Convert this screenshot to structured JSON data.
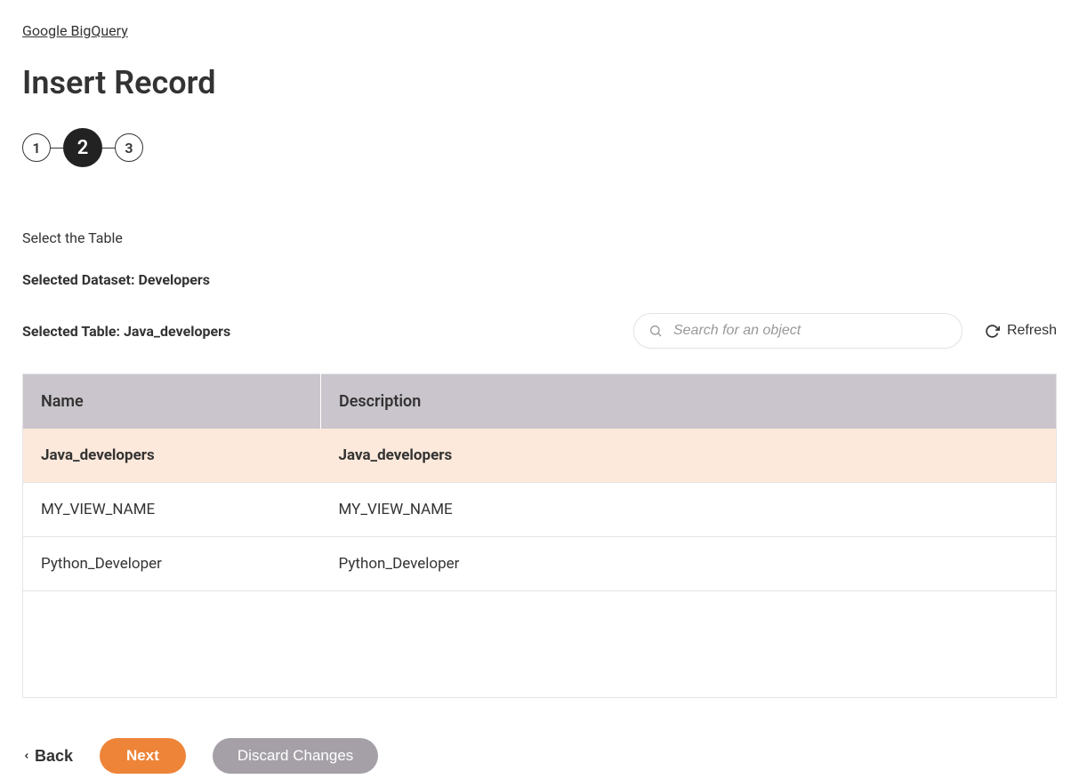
{
  "breadcrumb": {
    "label": "Google BigQuery"
  },
  "page_title": "Insert Record",
  "stepper": {
    "steps": [
      "1",
      "2",
      "3"
    ],
    "active_index": 1
  },
  "instruction": "Select the Table",
  "selected_dataset_line": "Selected Dataset: Developers",
  "selected_table_line": "Selected Table: Java_developers",
  "search": {
    "placeholder": "Search for an object"
  },
  "refresh_label": "Refresh",
  "table": {
    "headers": {
      "name": "Name",
      "description": "Description"
    },
    "rows": [
      {
        "name": "Java_developers",
        "description": "Java_developers",
        "selected": true
      },
      {
        "name": "MY_VIEW_NAME",
        "description": "MY_VIEW_NAME",
        "selected": false
      },
      {
        "name": "Python_Developer",
        "description": "Python_Developer",
        "selected": false
      }
    ]
  },
  "footer": {
    "back": "Back",
    "next": "Next",
    "discard": "Discard Changes"
  }
}
